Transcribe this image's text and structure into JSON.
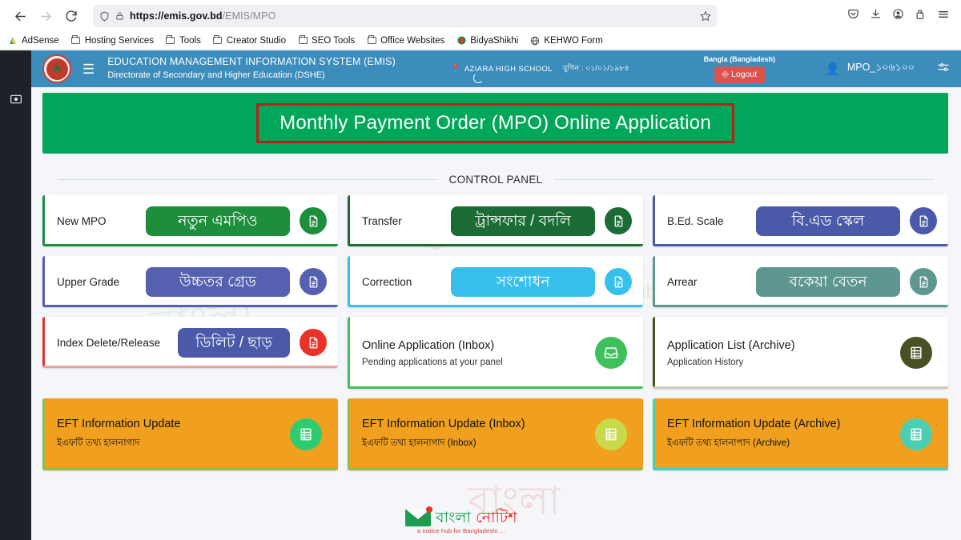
{
  "browser": {
    "back_icon": "back-arrow-icon",
    "forward_icon": "forward-arrow-icon",
    "reload_icon": "reload-icon",
    "shield_icon": "shield-icon",
    "lock_icon": "lock-icon",
    "url_domain": "https://emis.gov.bd",
    "url_path": "/EMIS/MPO",
    "url_full": "https://emis.gov.bd/EMIS/MPO",
    "bookmark_star_icon": "star-icon",
    "right_icons": [
      "pocket-icon",
      "downloads-icon",
      "account-icon",
      "extensions-icon",
      "menu-icon"
    ],
    "bookmarks": [
      {
        "label": "AdSense",
        "icon": "adsense-icon"
      },
      {
        "label": "Hosting Services",
        "icon": "folder-icon"
      },
      {
        "label": "Tools",
        "icon": "folder-icon"
      },
      {
        "label": "Creator Studio",
        "icon": "folder-icon"
      },
      {
        "label": "SEO Tools",
        "icon": "folder-icon"
      },
      {
        "label": "Office Websites",
        "icon": "folder-icon"
      },
      {
        "label": "BidyaShikhi",
        "icon": "bidyashikhi-icon"
      },
      {
        "label": "KEHWO Form",
        "icon": "globe-icon"
      }
    ]
  },
  "app_header": {
    "logo_icon": "bangladesh-govt-emblem-icon",
    "menu_icon": "hamburger-menu-icon",
    "title": "EDUCATION MANAGEMENT INFORMATION SYSTEM (EMIS)",
    "subtitle": "Directorate of Secondary and Higher Education (DSHE)",
    "location_icon": "map-pin-icon",
    "school_name": "AZIARA HIGH SCHOOL",
    "date_label": "যুগিন : ০১/০১/১৯৮৪",
    "language": "Bangla (Bangladesh)",
    "logout_label": "Logout",
    "logout_icon": "logout-icon",
    "user_icon": "user-avatar-icon",
    "user_name": "MPO_১০৬১০০",
    "settings_icon": "settings-sliders-icon",
    "bg_color": "#3c8dbc",
    "logout_color": "#d9534f"
  },
  "banner": {
    "title": "Monthly Payment Order (MPO) Online Application",
    "bg_color": "#00a65a",
    "border_color": "#b7211a"
  },
  "control_panel": {
    "label": "CONTROL PANEL"
  },
  "cards": {
    "row1": [
      {
        "en_label": "New MPO",
        "bn_label": "নতুন এমপিও",
        "pill_color": "#1d8e3c",
        "accent_color": "#1d8e3c",
        "icon": "document-icon",
        "icon_bg": "#1d8e3c",
        "icon_style": "filled"
      },
      {
        "en_label": "Transfer",
        "bn_label": "ট্রান্সফার / বদলি",
        "pill_color": "#1a6b34",
        "accent_color": "#1a6b34",
        "icon": "document-icon",
        "icon_bg": "#1a6b34",
        "icon_style": "filled"
      },
      {
        "en_label": "B.Ed. Scale",
        "bn_label": "বি.এড স্কেল",
        "pill_color": "#4a5aa8",
        "accent_color": "#4a5aa8",
        "icon": "document-icon",
        "icon_bg": "#4a5aa8",
        "icon_style": "filled"
      }
    ],
    "row2": [
      {
        "en_label": "Upper Grade",
        "bn_label": "উচ্চতর গ্রেড",
        "pill_color": "#5560b0",
        "accent_color": "#5560b0",
        "icon": "document-icon",
        "icon_bg": "#5560b0",
        "icon_style": "filled"
      },
      {
        "en_label": "Correction",
        "bn_label": "সংশোধন",
        "pill_color": "#37c0ee",
        "accent_color": "#37c0ee",
        "icon": "document-icon",
        "icon_bg": "#37c0ee",
        "icon_style": "filled"
      },
      {
        "en_label": "Arrear",
        "bn_label": "বকেয়া বেতন",
        "pill_color": "#5e9690",
        "accent_color": "#5e9690",
        "icon": "document-icon",
        "icon_bg": "#5e9690",
        "icon_style": "filled"
      }
    ],
    "row3": [
      {
        "type": "button",
        "en_label": "Index Delete/Release",
        "bn_label": "ডিলিট / ছাড়",
        "pill_color": "#4a5aa8",
        "accent_color": "#e8322a",
        "icon": "document-icon",
        "icon_bg": "#e8322a",
        "icon_style": "filled"
      },
      {
        "type": "text",
        "title": "Online Application (Inbox)",
        "subtitle": "Pending applications at your panel",
        "accent_color": "#3ec15c",
        "icon": "inbox-icon",
        "icon_bg": "#3ec15c"
      },
      {
        "type": "text",
        "title": "Application List (Archive)",
        "subtitle": "Application History",
        "accent_color": "#4a4f24",
        "icon": "list-icon",
        "icon_bg": "#4a4f24"
      }
    ],
    "row4": [
      {
        "title": "EFT Information Update",
        "subtitle": "ইএফটি তথ্য হালনাগাদ",
        "bg_color": "#f0a01e",
        "accent_color": "#8fbf4a",
        "icon": "list-icon",
        "icon_bg": "#2ecc71"
      },
      {
        "title": "EFT Information Update (Inbox)",
        "subtitle": "ইএফটি তথ্য হালনাগাদ (Inbox)",
        "bg_color": "#f0a01e",
        "accent_color": "#8fbf4a",
        "icon": "list-icon",
        "icon_bg": "#c8d94a"
      },
      {
        "title": "EFT Information Update (Archive)",
        "subtitle": "ইএফটি তথ্য হালনাপাদ (Archive)",
        "bg_color": "#f0a01e",
        "accent_color": "#4ad0b0",
        "icon": "list-icon",
        "icon_bg": "#4ad0b0"
      }
    ]
  },
  "footer_logo": {
    "word1": "বাংলা",
    "word2": "নোটিশ",
    "tagline": "a notice hub for Bangladeshi ...",
    "icon": "envelope-icon"
  },
  "watermarks": {
    "w1": "নোটিশ",
    "w2": "বাংলা",
    "w3": "a notice hub for Bangladeshi ...",
    "w4": "বাংলা"
  }
}
